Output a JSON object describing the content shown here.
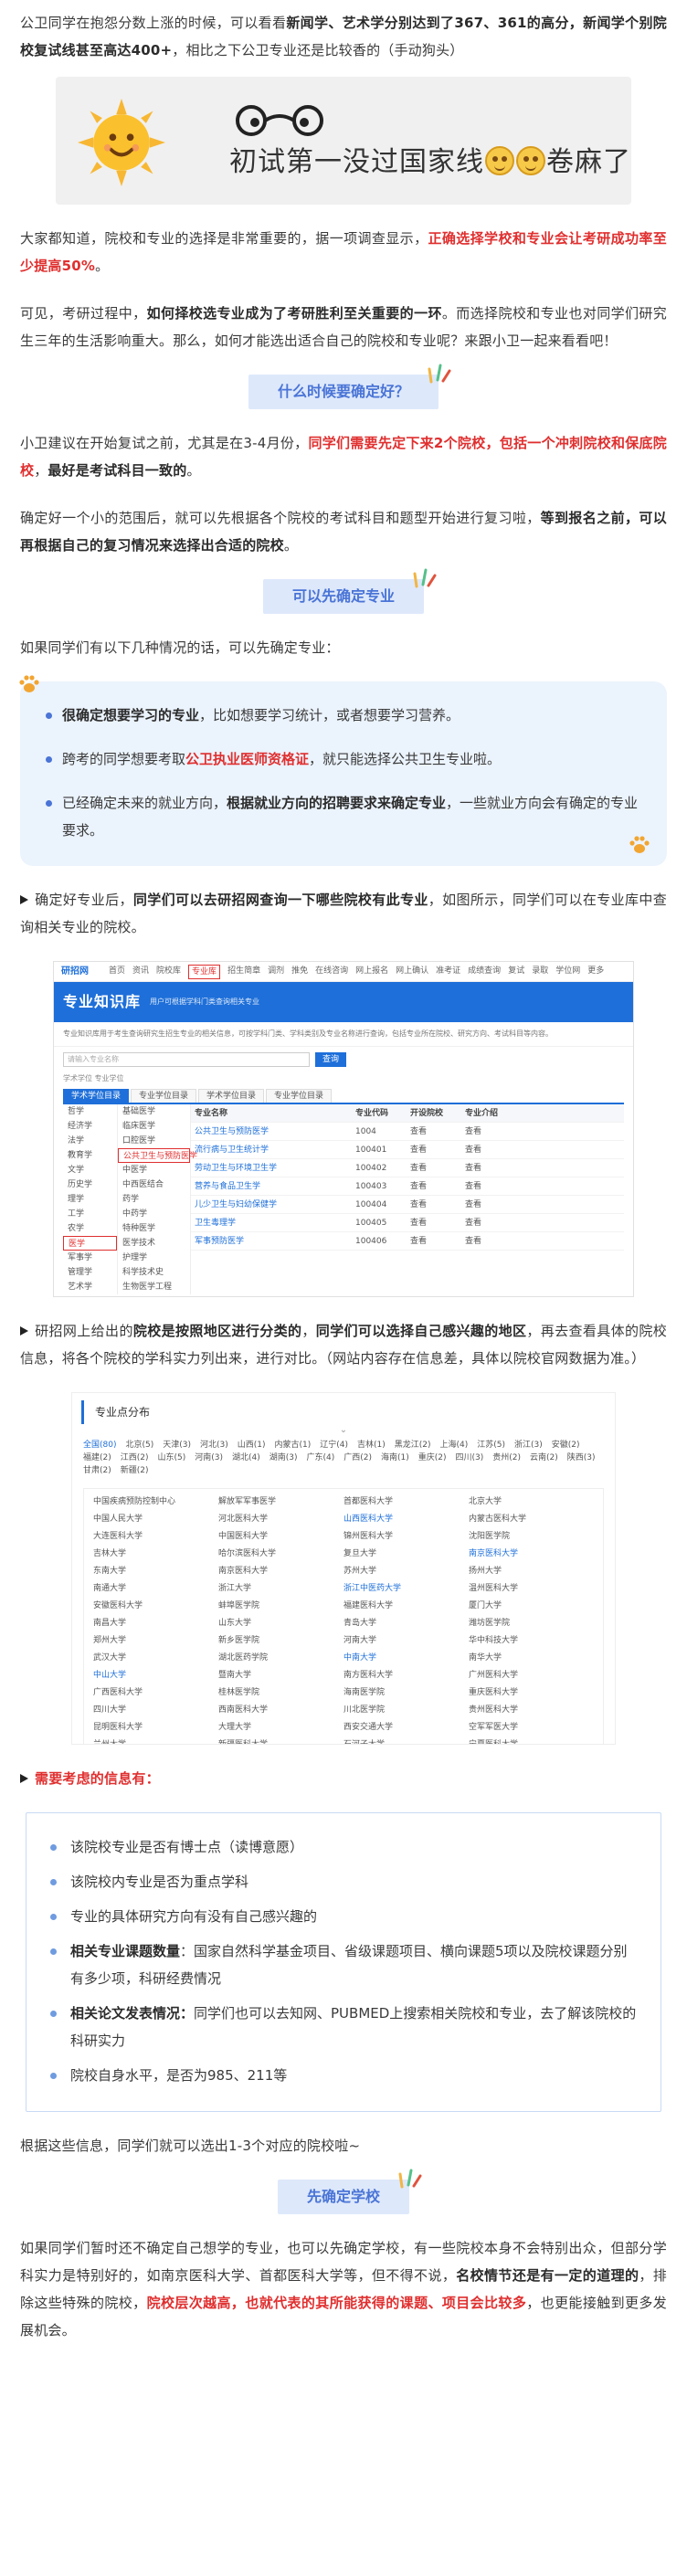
{
  "intro": {
    "p1_a": "公卫同学在抱怨分数上涨的时候，可以看看",
    "p1_b": "新闻学、艺术学分别达到了367、361的高分，新闻学个别院校复试线甚至高达400+",
    "p1_c": "，相比之下公卫专业还是比较香的（手动狗头）"
  },
  "banner": {
    "text": "初试第一没过国家线",
    "text_tail": "卷麻了",
    "icons": [
      "sun-face-icon",
      "glasses-icon",
      "grimace-emoji-icon"
    ]
  },
  "para2": {
    "a": "大家都知道，院校和专业的选择是非常重要的，据一项调查显示，",
    "b": "正确选择学校和专业会让考研成功率至少提高50%",
    "c": "。"
  },
  "para3": {
    "a": "可见，考研过程中，",
    "b": "如何择校选专业成为了考研胜利至关重要的一环",
    "c": "。而选择院校和专业也对同学们研究生三年的生活影响重大。那么，如何才能选出适合自己的院校和专业呢？来跟小卫一起来看看吧！"
  },
  "h1": "什么时候要确定好？",
  "para4": {
    "a": "小卫建议在开始复试之前，尤其是在3-4月份，",
    "b": "同学们需要先定下来2个院校，包括一个冲刺院校和保底院校",
    "c": "，",
    "d": "最好是考试科目一致的",
    "e": "。"
  },
  "para5": {
    "a": "确定好一个小的范围后，就可以先根据各个院校的考试科目和题型开始进行复习啦，",
    "b": "等到报名之前，可以再根据自己的复习情况来选择出合适的院校",
    "c": "。"
  },
  "h2": "可以先确定专业",
  "para6": "如果同学们有以下几种情况的话，可以先确定专业：",
  "callout": {
    "i1_a": "很确定想要学习的专业",
    "i1_b": "，比如想要学习统计，或者想要学习营养。",
    "i2_a": "跨考的同学想要考取",
    "i2_b": "公卫执业医师资格证",
    "i2_c": "，就只能选择公共卫生专业啦。",
    "i3_a": "已经确定未来的就业方向，",
    "i3_b": "根据就业方向的招聘要求来确定专业",
    "i3_c": "，一些就业方向会有确定的专业要求。"
  },
  "para7": {
    "a": "确定好专业后，",
    "b": "同学们可以去研招网查询一下哪些院校有此专业",
    "c": "，如图所示，同学们可以在专业库中查询相关专业的院校。"
  },
  "shot1": {
    "logo": "研招网",
    "nav": [
      "首页",
      "资讯",
      "院校库",
      "专业库",
      "招生简章",
      "调剂",
      "推免",
      "在线咨询",
      "网上报名",
      "网上确认",
      "准考证",
      "成绩查询",
      "复试",
      "录取",
      "学位网",
      "更多"
    ],
    "title": "专业知识库",
    "subtitle": "用户可根据学科门类查询相关专业",
    "desc": "专业知识库用于考生查询研究生招生专业的相关信息，可按学科门类、学科类别及专业名称进行查询，包括专业所在院校、研究方向、考试科目等内容。",
    "search_btn": "查询",
    "search_placeholder": "请输入专业名称",
    "radios": "学术学位    专业学位",
    "tabs": [
      "学术学位目录",
      "专业学位目录",
      "学术学位目录",
      "专业学位目录"
    ],
    "col1": [
      "哲学",
      "经济学",
      "法学",
      "教育学",
      "文学",
      "历史学",
      "理学",
      "工学",
      "农学",
      "医学",
      "军事学",
      "管理学",
      "艺术学"
    ],
    "col2": [
      "基础医学",
      "临床医学",
      "口腔医学",
      "公共卫生与预防医学",
      "中医学",
      "中西医结合",
      "药学",
      "中药学",
      "特种医学",
      "医学技术",
      "护理学",
      "科学技术史",
      "生物医学工程"
    ],
    "table_head": [
      "专业名称",
      "专业代码",
      "开设院校",
      "专业介绍"
    ],
    "rows": [
      [
        "公共卫生与预防医学",
        "1004",
        "查看",
        "查看"
      ],
      [
        "流行病与卫生统计学",
        "100401",
        "查看",
        "查看"
      ],
      [
        "劳动卫生与环境卫生学",
        "100402",
        "查看",
        "查看"
      ],
      [
        "营养与食品卫生学",
        "100403",
        "查看",
        "查看"
      ],
      [
        "儿少卫生与妇幼保健学",
        "100404",
        "查看",
        "查看"
      ],
      [
        "卫生毒理学",
        "100405",
        "查看",
        "查看"
      ],
      [
        "军事预防医学",
        "100406",
        "查看",
        "查看"
      ]
    ]
  },
  "para8": {
    "a": "研招网上给出的",
    "b": "院校是按照地区进行分类的",
    "c": "，",
    "d": "同学们可以选择自己感兴趣的地区",
    "e": "，再去查看具体的院校信息，将各个院校的学科实力列出来，进行对比。（网站内容存在信息差，具体以院校官网数据为准。）"
  },
  "shot2": {
    "title": "专业点分布",
    "regions": [
      "全国(80)",
      "北京(5)",
      "天津(3)",
      "河北(3)",
      "山西(1)",
      "内蒙古(1)",
      "辽宁(4)",
      "吉林(1)",
      "黑龙江(2)",
      "上海(4)",
      "江苏(5)",
      "浙江(3)",
      "安徽(2)",
      "福建(2)",
      "江西(2)",
      "山东(5)",
      "河南(3)",
      "湖北(4)",
      "湖南(3)",
      "广东(4)",
      "广西(2)",
      "海南(1)",
      "重庆(2)",
      "四川(3)",
      "贵州(2)",
      "云南(2)",
      "陕西(3)",
      "甘肃(2)",
      "新疆(2)"
    ],
    "schools": [
      "中国疾病预防控制中心",
      "解放军军事医学",
      "首都医科大学",
      "北京大学",
      "中国人民大学",
      "河北医科大学",
      "山西医科大学",
      "内蒙古医科大学",
      "大连医科大学",
      "中国医科大学",
      "锦州医科大学",
      "沈阳医学院",
      "吉林大学",
      "哈尔滨医科大学",
      "复旦大学",
      "南京医科大学",
      "东南大学",
      "南京医科大学",
      "苏州大学",
      "扬州大学",
      "南通大学",
      "浙江大学",
      "浙江中医药大学",
      "温州医科大学",
      "安徽医科大学",
      "蚌埠医学院",
      "福建医科大学",
      "厦门大学",
      "南昌大学",
      "山东大学",
      "青岛大学",
      "潍坊医学院",
      "郑州大学",
      "新乡医学院",
      "河南大学",
      "华中科技大学",
      "武汉大学",
      "湖北医药学院",
      "中南大学",
      "南华大学",
      "中山大学",
      "暨南大学",
      "南方医科大学",
      "广州医科大学",
      "广西医科大学",
      "桂林医学院",
      "海南医学院",
      "重庆医科大学",
      "四川大学",
      "西南医科大学",
      "川北医学院",
      "贵州医科大学",
      "昆明医科大学",
      "大理大学",
      "西安交通大学",
      "空军军医大学",
      "兰州大学",
      "新疆医科大学",
      "石河子大学",
      "宁夏医科大学"
    ]
  },
  "para9": "需要考虑的信息有：",
  "list": {
    "l1": "该院校专业是否有博士点（读博意愿）",
    "l2": "该院校内专业是否为重点学科",
    "l3": "专业的具体研究方向有没有自己感兴趣的",
    "l4_a": "相关专业课题数量",
    "l4_b": "：国家自然科学基金项目、省级课题项目、横向课题5项以及院校课题分别有多少项，科研经费情况",
    "l5_a": "相关论文发表情况：",
    "l5_b": "同学们也可以去知网、PUBMED上搜索相关院校和专业，去了解该院校的科研实力",
    "l6": "院校自身水平，是否为985、211等"
  },
  "para10": "根据这些信息，同学们就可以选出1-3个对应的院校啦~",
  "h3": "先确定学校",
  "para11": {
    "a": "如果同学们暂时还不确定自己想学的专业，也可以先确定学校，有一些院校本身不会特别出众，但部分学科实力是特别好的，如南京医科大学、首都医科大学等，但不得不说，",
    "b": "名校情节还是有一定的道理的",
    "c": "，排除这些特殊的院校，",
    "d": "院校层次越高，也就代表的其所能获得的课题、项目会比较多",
    "e": "，也更能接触到更多发展机会。"
  }
}
